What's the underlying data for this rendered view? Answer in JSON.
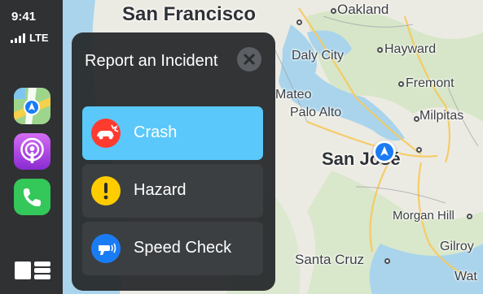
{
  "status": {
    "time": "9:41",
    "network": "LTE"
  },
  "sidebar": {
    "apps": [
      {
        "name": "Maps",
        "icon": "maps-icon"
      },
      {
        "name": "Podcasts",
        "icon": "podcasts-icon"
      },
      {
        "name": "Phone",
        "icon": "phone-icon"
      }
    ],
    "dashboard_icon": "dashboard-icon"
  },
  "map": {
    "cities": [
      "San Francisco",
      "Oakland",
      "Daly City",
      "Hayward",
      "Fremont",
      "Mateo",
      "Palo Alto",
      "Milpitas",
      "San José",
      "Morgan Hill",
      "Gilroy",
      "Santa Cruz",
      "Wat"
    ]
  },
  "panel": {
    "title": "Report an Incident",
    "options": [
      {
        "label": "Crash",
        "icon": "crash-icon",
        "color": "#ff3b30",
        "selected": true
      },
      {
        "label": "Hazard",
        "icon": "hazard-icon",
        "color": "#ffcc00",
        "selected": false
      },
      {
        "label": "Speed Check",
        "icon": "speed-check-icon",
        "color": "#1a7cf5",
        "selected": false
      }
    ]
  },
  "colors": {
    "selection": "#5ac8fa",
    "panel": "#26282a",
    "water": "#a7d3ec",
    "land": "#eceae2"
  }
}
